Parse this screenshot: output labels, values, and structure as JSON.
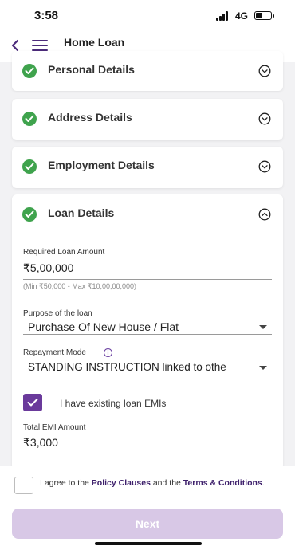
{
  "status_bar": {
    "time": "3:58",
    "network": "4G"
  },
  "header": {
    "title": "Home Loan"
  },
  "sections": [
    {
      "title": "Personal Details",
      "completed": true,
      "expanded": false
    },
    {
      "title": "Address Details",
      "completed": true,
      "expanded": false
    },
    {
      "title": "Employment Details",
      "completed": true,
      "expanded": false
    },
    {
      "title": "Loan Details",
      "completed": true,
      "expanded": true
    }
  ],
  "loan_form": {
    "amount_label": "Required Loan Amount",
    "amount_value": "₹5,00,000",
    "amount_hint": "(Min ₹50,000 - Max ₹10,00,00,000)",
    "purpose_label": "Purpose of the loan",
    "purpose_value": "Purchase Of New House / Flat",
    "repayment_label": "Repayment Mode",
    "repayment_value": "STANDING INSTRUCTION linked to othe",
    "existing_emi_label": "I have existing loan EMIs",
    "existing_emi_checked": true,
    "total_emi_label": "Total EMI Amount",
    "total_emi_value": "₹3,000"
  },
  "agreement": {
    "prefix": "I agree to the ",
    "policy_link": "Policy Clauses",
    "middle": " and the ",
    "terms_link": "Terms & Conditions",
    "suffix": ".",
    "checked": false
  },
  "next_button": {
    "label": "Next",
    "enabled": false
  },
  "colors": {
    "brand": "#6a3a9b",
    "success": "#3fa34d",
    "next_disabled": "#d8c8e6"
  }
}
